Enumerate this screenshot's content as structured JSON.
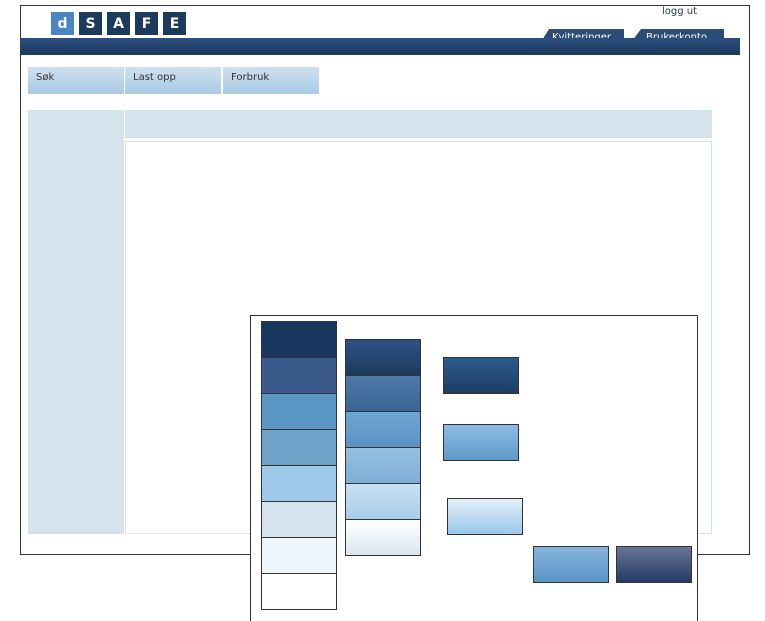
{
  "logo": {
    "letters": [
      "d",
      "S",
      "A",
      "F",
      "E"
    ]
  },
  "header": {
    "logout_label": "logg ut",
    "tabs": [
      {
        "label": "Kvitteringer"
      },
      {
        "label": "Brukerkonto"
      }
    ]
  },
  "nav": {
    "items": [
      {
        "label": "Søk"
      },
      {
        "label": "Last opp"
      },
      {
        "label": "Forbruk"
      }
    ]
  },
  "palette": {
    "column1": [
      "#17375e",
      "#3a5a8c",
      "#5b97c6",
      "#6ea3c9",
      "#9ec9e8",
      "#d6e3ec",
      "#eef6fb",
      "#ffffff"
    ],
    "column2": [
      {
        "from": "#2c5285",
        "to": "#1c3a5c"
      },
      {
        "from": "#4e7aaa",
        "to": "#3a6494"
      },
      {
        "from": "#6fa5d3",
        "to": "#5a93c3"
      },
      {
        "from": "#97c0e2",
        "to": "#7eadd6"
      },
      {
        "from": "#c9e2f3",
        "to": "#a8cceb"
      },
      {
        "from": "#ffffff",
        "to": "#d9e7f0"
      }
    ],
    "samples": [
      {
        "from": "#2e5b8c",
        "to": "#1d3d63"
      },
      {
        "from": "#8dbde4",
        "to": "#5e99c9"
      },
      {
        "from": "#e2f0fa",
        "to": "#9cc8ea"
      },
      {
        "from": "#86b5de",
        "to": "#5b94c6"
      },
      {
        "from": "#6a7597",
        "to": "#243a66"
      }
    ]
  }
}
